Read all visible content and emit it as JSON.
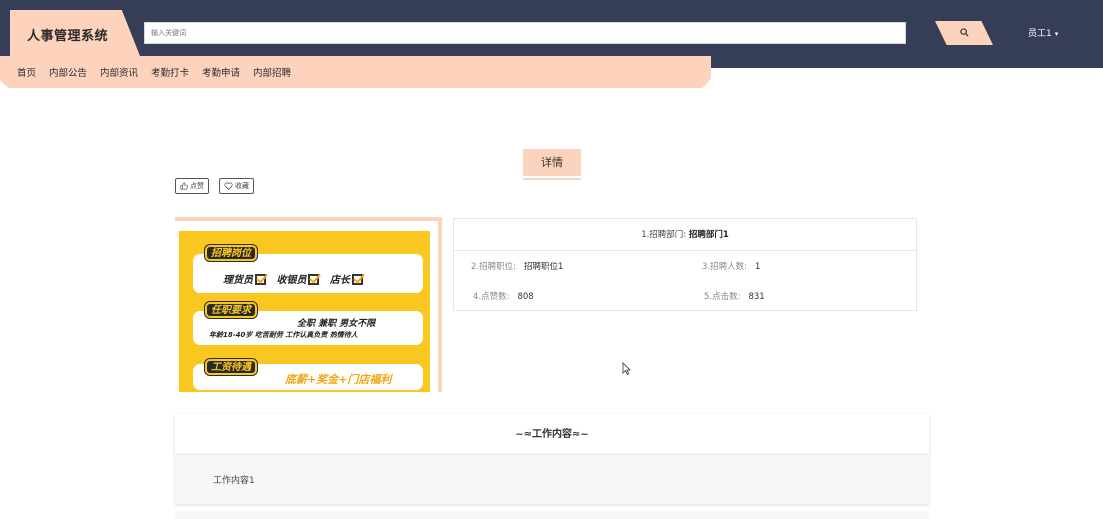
{
  "header": {
    "brand": "人事管理系统",
    "search_placeholder": "输入关键词",
    "user_label": "员工1"
  },
  "nav": {
    "items": [
      "首页",
      "内部公告",
      "内部资讯",
      "考勤打卡",
      "考勤申请",
      "内部招聘"
    ]
  },
  "detail": {
    "tab_label": "详情",
    "like_label": "点赞",
    "collect_label": "收藏"
  },
  "poster": {
    "tag1": "招聘岗位",
    "roles": [
      "理货员",
      "收银员",
      "店长"
    ],
    "tag2": "任职要求",
    "req_line1": "全职  兼职  男女不限",
    "req_line2": "年龄18-40岁  吃苦耐劳  工作认真负责  热情待人",
    "tag3": "工资待遇",
    "salary": "底薪+奖金+门店福利"
  },
  "info": {
    "dept_label": "1.招聘部门:",
    "dept_value": "招聘部门1",
    "position_label": "2.招聘职位:",
    "position_value": "招聘职位1",
    "count_label": "3.招聘人数:",
    "count_value": "1",
    "likes_label": "4.点赞数:",
    "likes_value": "808",
    "clicks_label": "5.点击数:",
    "clicks_value": "831"
  },
  "work": {
    "title": "工作内容",
    "content": "工作内容1"
  },
  "colors": {
    "topbar": "#353d57",
    "accent": "#fdd3bd",
    "poster_yellow": "#f9c71f"
  },
  "icons": [
    "search-icon",
    "thumbs-up-icon",
    "heart-icon",
    "caret-down-icon",
    "mouse-cursor-icon"
  ]
}
